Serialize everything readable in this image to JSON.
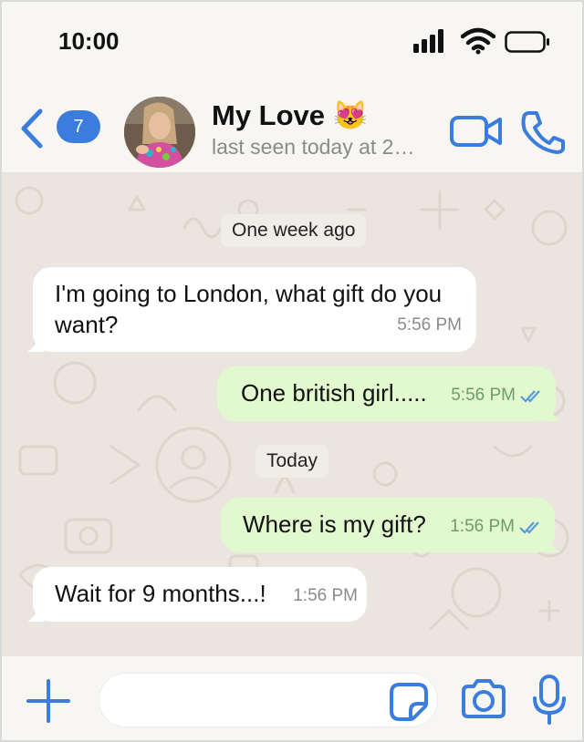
{
  "status": {
    "time": "10:00",
    "icons": [
      "cellular-signal-icon",
      "wifi-icon",
      "battery-icon"
    ]
  },
  "header": {
    "unread_count": "7",
    "contact_name": "My Love 😻",
    "last_seen": "last seen today at 2…",
    "icons": [
      "back-chevron-icon",
      "video-call-icon",
      "phone-call-icon"
    ]
  },
  "chat": {
    "date_dividers": [
      "One week ago",
      "Today"
    ],
    "messages": [
      {
        "direction": "incoming",
        "text": "I'm going to London, what gift do you want?",
        "time": "5:56 PM"
      },
      {
        "direction": "outgoing",
        "text": "One british girl.....",
        "time": "5:56 PM",
        "status": "read"
      },
      {
        "direction": "outgoing",
        "text": "Where is my gift?",
        "time": "1:56 PM",
        "status": "read"
      },
      {
        "direction": "incoming",
        "text": "Wait for 9 months...!",
        "time": "1:56 PM"
      }
    ]
  },
  "input_bar": {
    "message_value": "",
    "icons": [
      "plus-icon",
      "sticker-icon",
      "camera-icon",
      "microphone-icon"
    ]
  },
  "colors": {
    "accent": "#3b7ddd",
    "outgoing_bubble": "#e2f8cf",
    "incoming_bubble": "#ffffff",
    "chat_background": "#eae6df",
    "read_ticks": "#5b9bdc"
  }
}
